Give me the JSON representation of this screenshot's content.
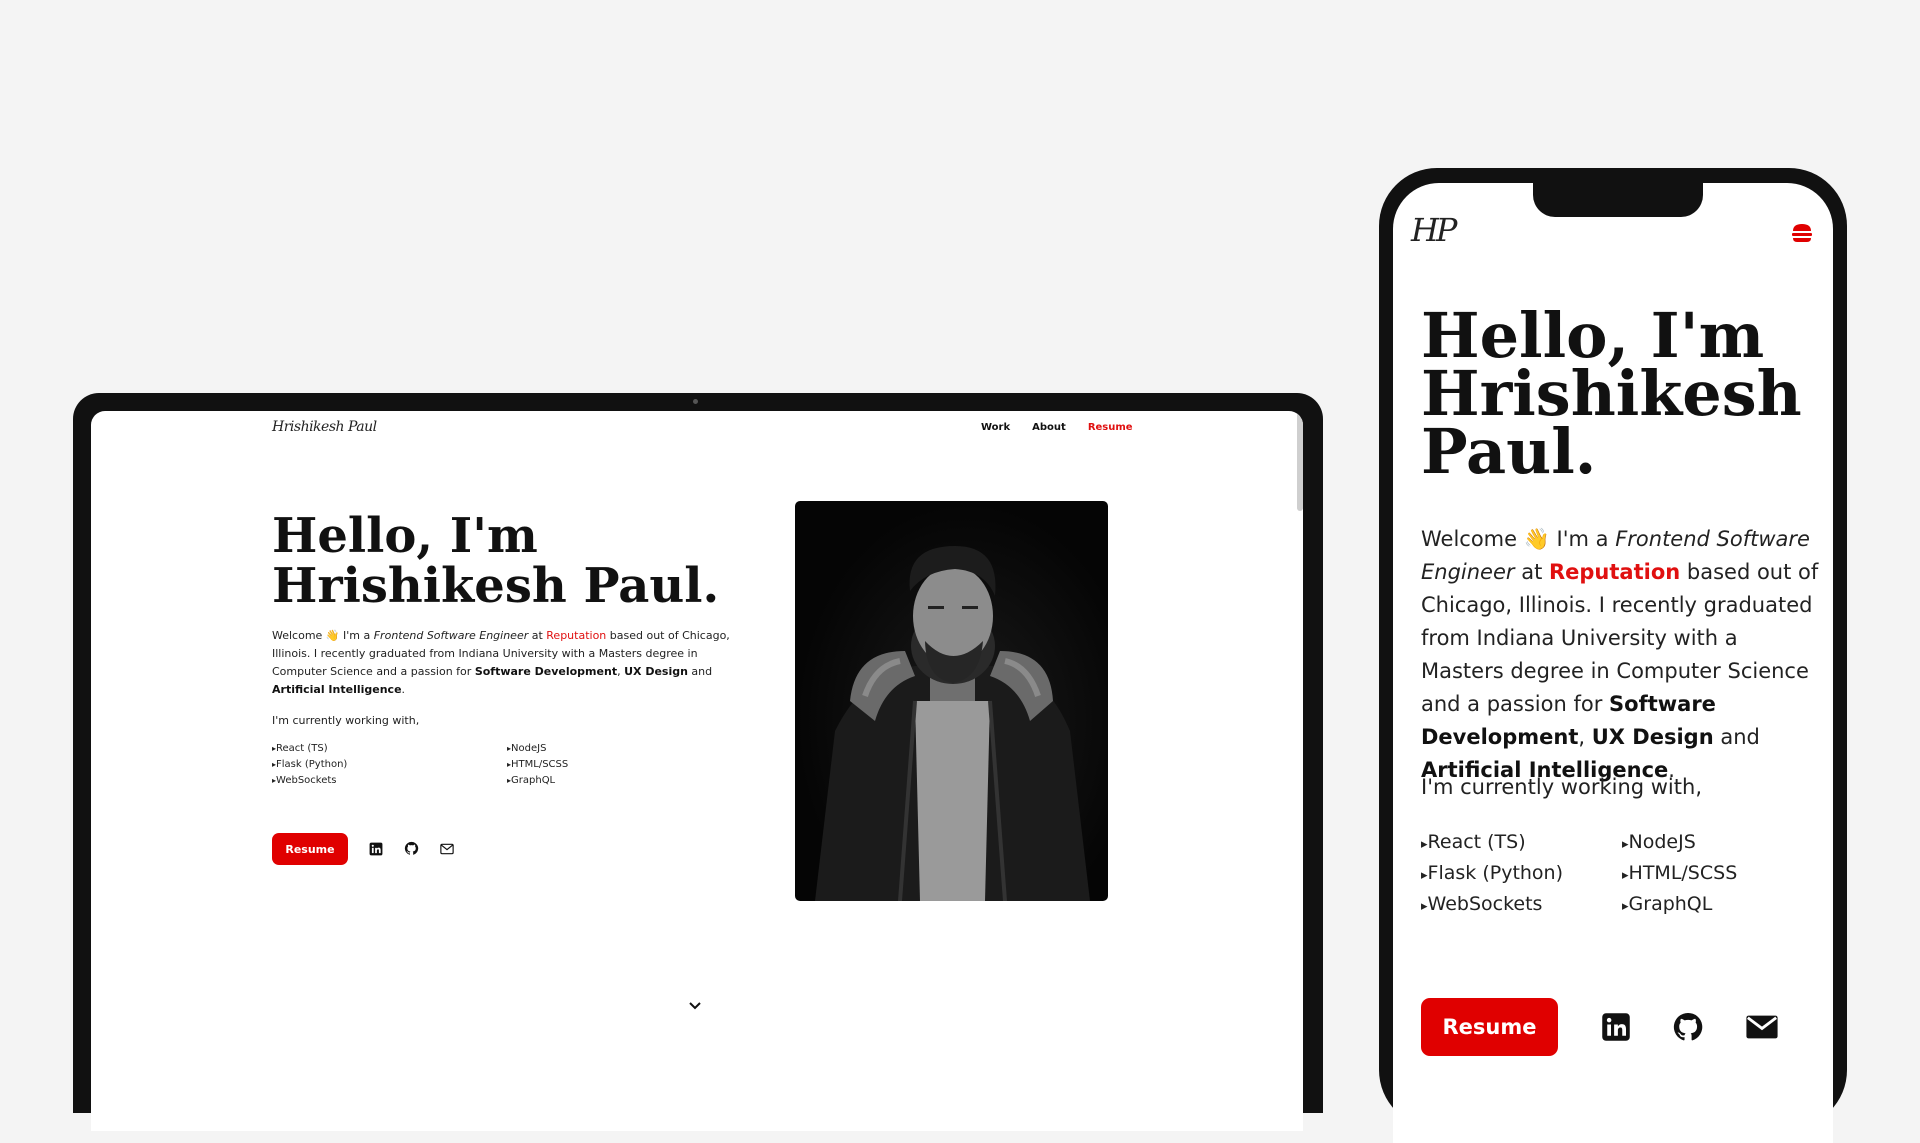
{
  "laptop": {
    "logo_text": "Hrishikesh Paul",
    "nav": {
      "work": "Work",
      "about": "About",
      "resume": "Resume"
    },
    "hero": {
      "title_line1": "Hello, I'm",
      "title_line2": "Hrishikesh Paul."
    }
  },
  "intro": {
    "welcome": "Welcome 👋 I'm a ",
    "role": "Frontend Software Engineer",
    "at": " at ",
    "company": "Reputation",
    "rest": " based out of Chicago, Illinois. I recently graduated from Indiana University with a Masters degree in Computer Science and a passion for ",
    "skill1": "Software Development",
    "comma": ", ",
    "skill2": "UX Design",
    "and": " and ",
    "skill3": "Artificial Intelligence",
    "period": "."
  },
  "working_with": "I'm currently working with,",
  "tech_col1": [
    "React (TS)",
    "Flask (Python)",
    "WebSockets"
  ],
  "tech_col2": [
    "NodeJS",
    "HTML/SCSS",
    "GraphQL"
  ],
  "resume_button": "Resume",
  "icons": [
    "linkedin-icon",
    "github-icon",
    "mail-icon",
    "chevron-down-icon",
    "hamburger-menu-icon"
  ],
  "phone": {
    "logo_text": "HP",
    "title_line1": "Hello, I'm",
    "title_line2": "Hrishikesh",
    "title_line3": "Paul."
  },
  "colors": {
    "accent": "#e00000",
    "background": "#f4f4f4",
    "device": "#111111"
  }
}
